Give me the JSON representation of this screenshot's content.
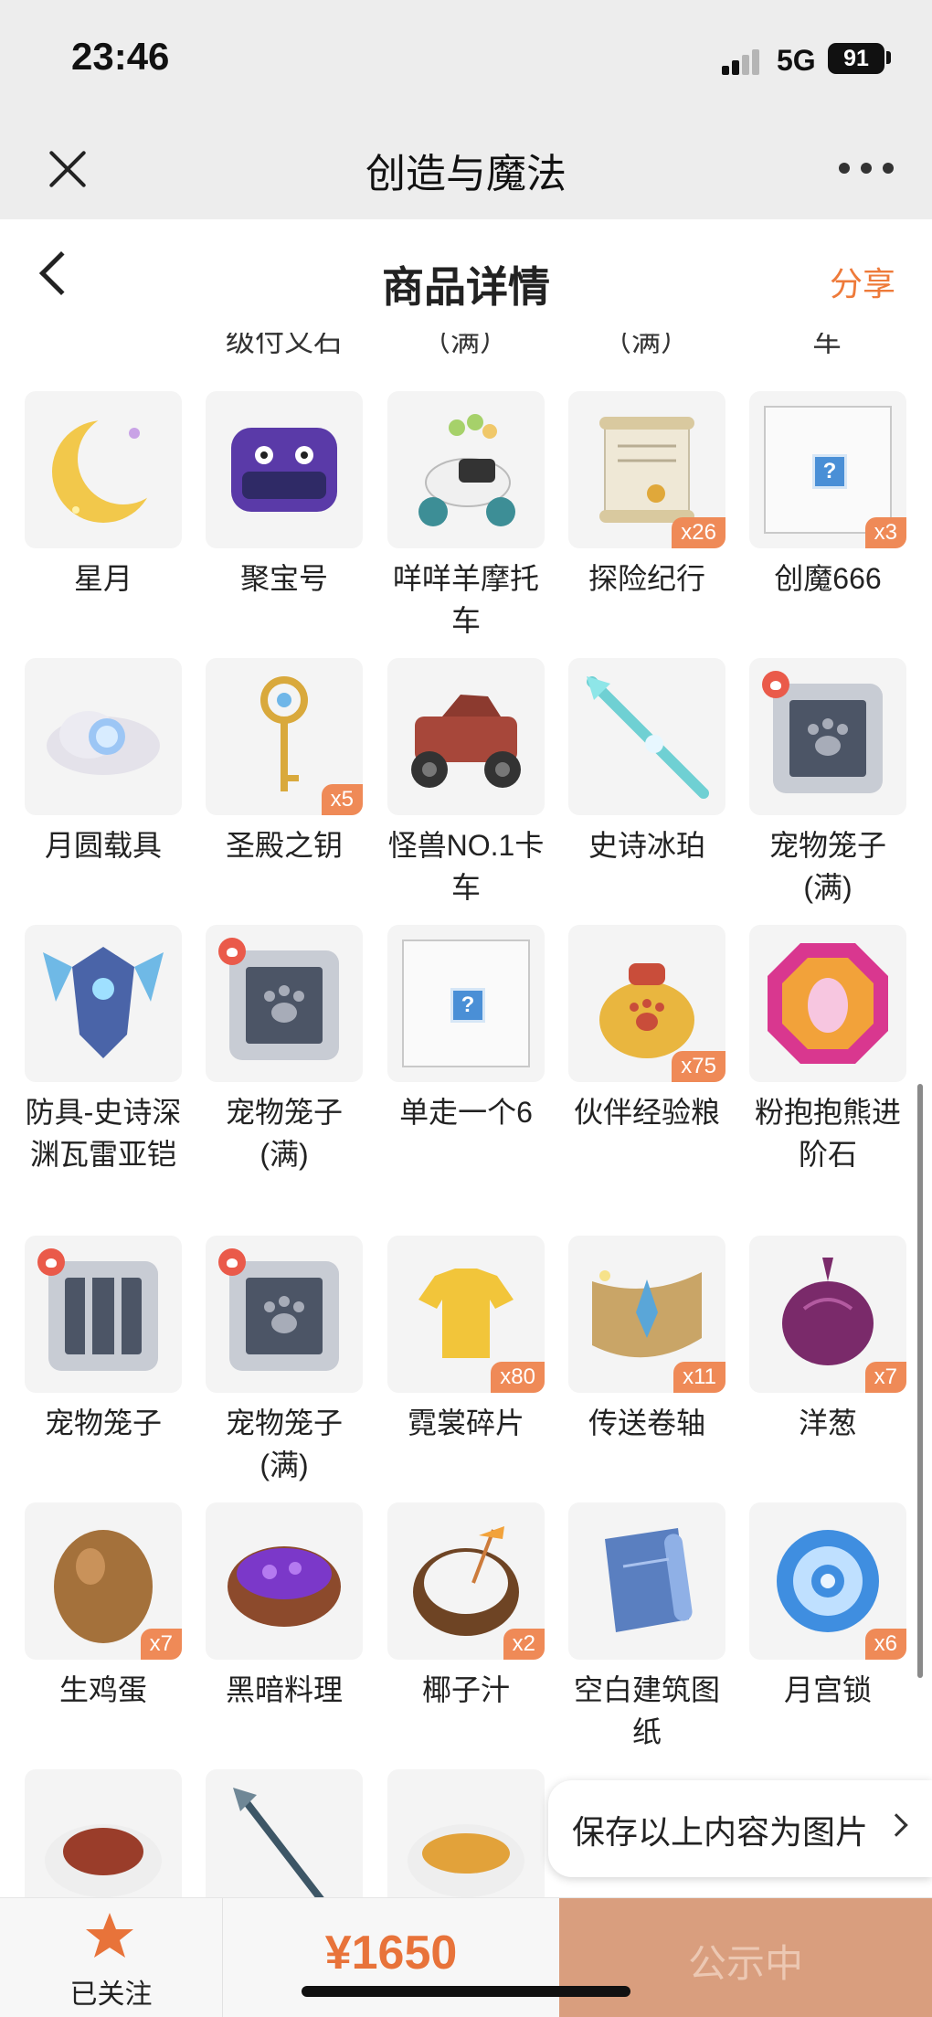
{
  "status_bar": {
    "time": "23:46",
    "network": "5G",
    "battery": "91"
  },
  "app_header": {
    "title": "创造与魔法"
  },
  "nav": {
    "title": "商品详情",
    "share": "分享"
  },
  "cut_labels": [
    "级付又石",
    "（满）",
    "（满）",
    "车"
  ],
  "items": [
    {
      "name": "星月",
      "qty": "",
      "icon": "crescent-moon-icon"
    },
    {
      "name": "聚宝号",
      "qty": "",
      "icon": "purple-mount-icon"
    },
    {
      "name": "咩咩羊摩托车",
      "qty": "",
      "icon": "sheep-motorbike-icon"
    },
    {
      "name": "探险纪行",
      "qty": "x26",
      "icon": "scroll-icon"
    },
    {
      "name": "创魔666",
      "qty": "x3",
      "icon": "unknown-item-icon"
    },
    {
      "name": "月圆载具",
      "qty": "",
      "icon": "moon-cloud-icon"
    },
    {
      "name": "圣殿之钥",
      "qty": "x5",
      "icon": "golden-key-icon"
    },
    {
      "name": "怪兽NO.1卡车",
      "qty": "",
      "icon": "monster-truck-icon"
    },
    {
      "name": "史诗冰珀",
      "qty": "",
      "icon": "ice-spear-icon"
    },
    {
      "name": "宠物笼子(满)",
      "qty": "",
      "icon": "pet-cage-full-icon"
    },
    {
      "name": "防具-史诗深渊瓦雷亚铠",
      "qty": "",
      "icon": "armor-icon"
    },
    {
      "name": "宠物笼子(满)",
      "qty": "",
      "icon": "pet-cage-full-icon"
    },
    {
      "name": "单走一个6",
      "qty": "",
      "icon": "unknown-item-icon"
    },
    {
      "name": "伙伴经验粮",
      "qty": "x75",
      "icon": "food-bag-icon"
    },
    {
      "name": "粉抱抱熊进阶石",
      "qty": "",
      "icon": "gem-stone-icon"
    },
    {
      "name": "宠物笼子",
      "qty": "",
      "icon": "pet-cage-empty-icon"
    },
    {
      "name": "宠物笼子(满)",
      "qty": "",
      "icon": "pet-cage-full-icon"
    },
    {
      "name": "霓裳碎片",
      "qty": "x80",
      "icon": "shirt-shard-icon"
    },
    {
      "name": "传送卷轴",
      "qty": "x11",
      "icon": "teleport-scroll-icon"
    },
    {
      "name": "洋葱",
      "qty": "x7",
      "icon": "onion-icon"
    },
    {
      "name": "生鸡蛋",
      "qty": "x7",
      "icon": "egg-icon"
    },
    {
      "name": "黑暗料理",
      "qty": "",
      "icon": "dark-dish-icon"
    },
    {
      "name": "椰子汁",
      "qty": "x2",
      "icon": "coconut-icon"
    },
    {
      "name": "空白建筑图纸",
      "qty": "",
      "icon": "blueprint-icon"
    },
    {
      "name": "月宫锁",
      "qty": "x6",
      "icon": "moon-lock-icon"
    }
  ],
  "partial_items": [
    "meat-dish-icon",
    "spear-icon",
    "fish-dish-icon"
  ],
  "save_float": {
    "label": "保存以上内容为图片"
  },
  "bottom_bar": {
    "follow_label": "已关注",
    "price": "¥1650",
    "buy_label": "公示中"
  },
  "colors": {
    "accent": "#ee7a3a",
    "qty_badge": "#ef8a57",
    "buy_button": "#d99e7e"
  }
}
